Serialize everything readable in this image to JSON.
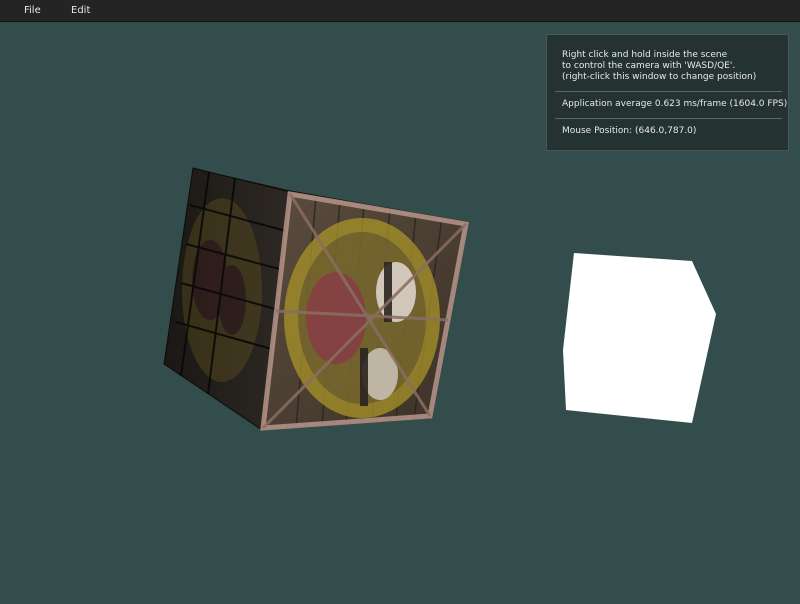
{
  "menubar": {
    "items": [
      {
        "label": "File"
      },
      {
        "label": "Edit"
      }
    ]
  },
  "overlay": {
    "help_lines": [
      "Right click and hold inside the scene",
      "to control the camera with 'WASD/QE'.",
      "(right-click this window to change position)"
    ],
    "fps_text": "Application average 0.623 ms/frame (1604.0 FPS)",
    "mouse_text": "Mouse Position: (646.0,787.0)"
  },
  "scene": {
    "background_color": "#334d4d",
    "objects": [
      {
        "name": "textured crate cube"
      },
      {
        "name": "white light cube"
      }
    ]
  }
}
